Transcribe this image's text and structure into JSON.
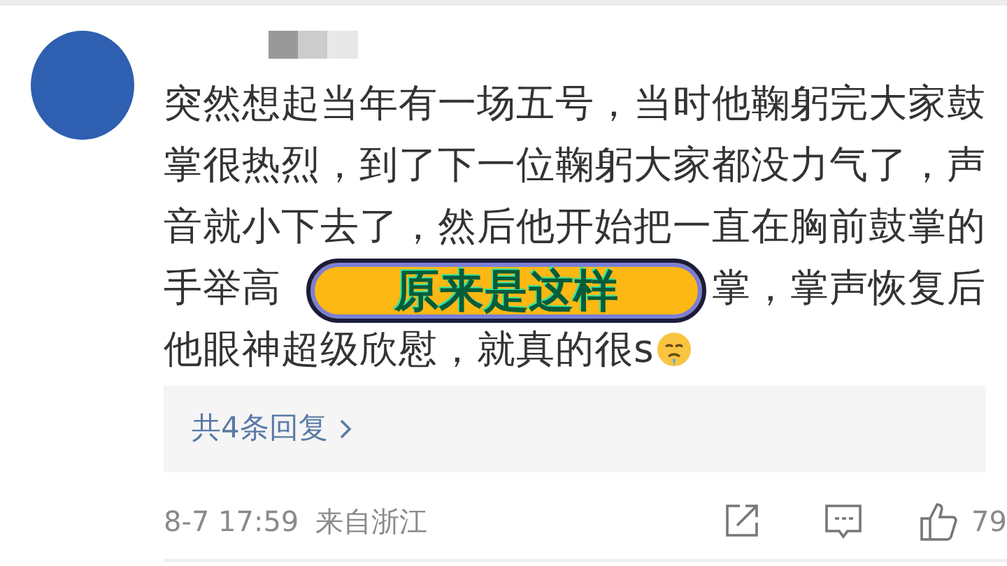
{
  "comment": {
    "lines": [
      {
        "parts": [
          "突然想起当年有一场五号，当时他鞠躬完大家鼓"
        ]
      },
      {
        "parts": [
          "掌很热烈，到了下一位鞠躬大家都没力气了，声"
        ]
      },
      {
        "parts": [
          "音就小下去了，然后他开始把一直在胸前鼓掌的"
        ]
      },
      {
        "parts": [
          "手举高",
          "掌，掌声恢复后"
        ]
      },
      {
        "parts": [
          "他眼神超级欣慰，就真的很s"
        ]
      }
    ]
  },
  "caption": "原来是这样",
  "replies_link": "共4条回复",
  "meta": {
    "time": "8-7 17:59",
    "location": "来自浙江",
    "likes": "79"
  }
}
